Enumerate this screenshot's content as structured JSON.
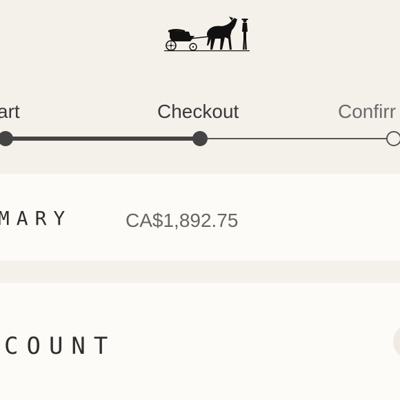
{
  "header": {
    "logo_icon": "horse-carriage-logo-icon"
  },
  "checkout_steps": [
    {
      "label": "Cart",
      "visible_label": "art",
      "state": "done"
    },
    {
      "label": "Checkout",
      "state": "current"
    },
    {
      "label": "Confirm",
      "visible_label": "Confirr",
      "state": "upcoming"
    }
  ],
  "summary": {
    "title": "MMARY",
    "amount": "CA$1,892.75"
  },
  "account": {
    "title": "COUNT"
  },
  "colors": {
    "background": "#f4f0ea",
    "panel": "#fcfbf7",
    "progress": "#444444"
  }
}
